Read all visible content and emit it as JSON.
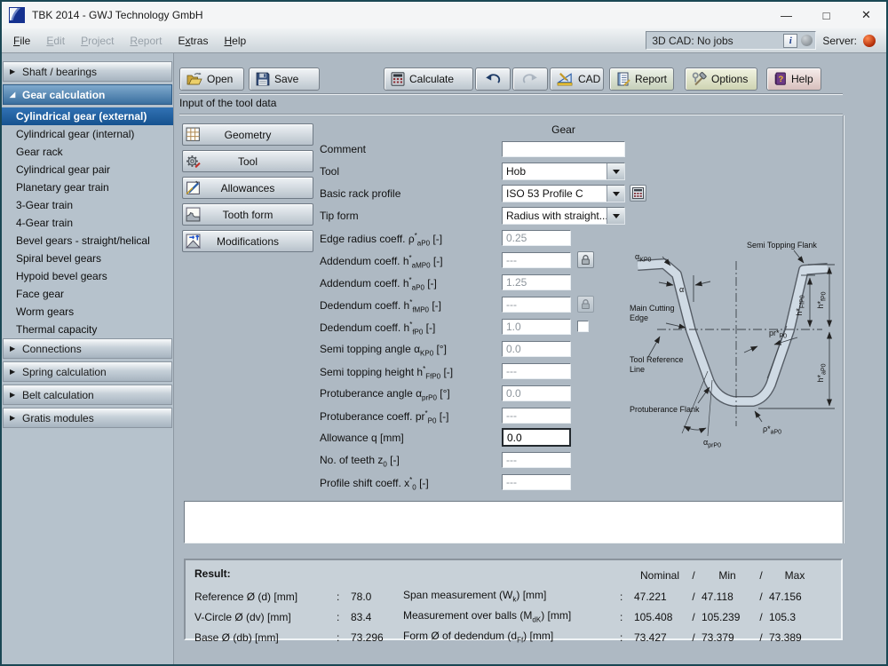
{
  "window": {
    "title": "TBK 2014 - GWJ Technology GmbH"
  },
  "titlebar": {
    "minimize": "—",
    "maximize": "□",
    "close": "✕"
  },
  "menubar": {
    "items": [
      {
        "label": "File",
        "u": 0,
        "enabled": true
      },
      {
        "label": "Edit",
        "u": 0,
        "enabled": false
      },
      {
        "label": "Project",
        "u": 0,
        "enabled": false
      },
      {
        "label": "Report",
        "u": 0,
        "enabled": false
      },
      {
        "label": "Extras",
        "u": 1,
        "enabled": true
      },
      {
        "label": "Help",
        "u": 0,
        "enabled": true
      }
    ],
    "cad_status": "3D CAD: No jobs",
    "info_button": "i",
    "server_label": "Server:"
  },
  "sidebar": {
    "groups": [
      {
        "label": "Shaft / bearings",
        "expanded": false
      },
      {
        "label": "Gear calculation",
        "expanded": true,
        "selected": "Cylindrical gear (external)",
        "items": [
          "Cylindrical gear (external)",
          "Cylindrical gear (internal)",
          "Gear rack",
          "Cylindrical gear pair",
          "Planetary gear train",
          "3-Gear train",
          "4-Gear train",
          "Bevel gears - straight/helical",
          "Spiral bevel gears",
          "Hypoid bevel gears",
          "Face gear",
          "Worm gears",
          "Thermal capacity"
        ]
      },
      {
        "label": "Connections",
        "expanded": false
      },
      {
        "label": "Spring calculation",
        "expanded": false
      },
      {
        "label": "Belt calculation",
        "expanded": false
      },
      {
        "label": "Gratis modules",
        "expanded": false
      }
    ]
  },
  "toolbar": {
    "open": "Open",
    "save": "Save",
    "calculate": "Calculate",
    "cad": "CAD",
    "report": "Report",
    "options": "Options",
    "help": "Help"
  },
  "section_title": "Input of the tool data",
  "buttons": {
    "geometry": "Geometry",
    "tool": "Tool",
    "allowances": "Allowances",
    "tooth_form": "Tooth form",
    "modifications": "Modifications"
  },
  "form": {
    "column_header": "Gear",
    "rows": [
      {
        "id": "comment",
        "label": [
          [
            "t",
            "Comment"
          ]
        ],
        "type": "text",
        "value": "",
        "state": "enabled",
        "wide": true
      },
      {
        "id": "tool",
        "label": [
          [
            "t",
            "Tool"
          ]
        ],
        "type": "select",
        "value": "Hob"
      },
      {
        "id": "basic-rack-profile",
        "label": [
          [
            "t",
            "Basic rack profile"
          ]
        ],
        "type": "select",
        "value": "ISO 53 Profile C",
        "extra": "calc"
      },
      {
        "id": "tip-form",
        "label": [
          [
            "t",
            "Tip form"
          ]
        ],
        "type": "select",
        "value": "Radius with straight..."
      },
      {
        "id": "edge-radius-coeff",
        "label": [
          [
            "t",
            "Edge radius coeff. ρ"
          ],
          [
            "sup",
            "*"
          ],
          [
            "sub",
            "aP0"
          ],
          [
            "t",
            " [-]"
          ]
        ],
        "type": "text",
        "value": "0.25",
        "state": "disabled"
      },
      {
        "id": "addendum-coeff-amp0",
        "label": [
          [
            "t",
            "Addendum coeff. h"
          ],
          [
            "sup",
            "*"
          ],
          [
            "sub",
            "aMP0"
          ],
          [
            "t",
            " [-]"
          ]
        ],
        "type": "text",
        "value": "---",
        "state": "disabled",
        "extra": "lock"
      },
      {
        "id": "addendum-coeff-ap0",
        "label": [
          [
            "t",
            "Addendum coeff. h"
          ],
          [
            "sup",
            "*"
          ],
          [
            "sub",
            "aP0"
          ],
          [
            "t",
            " [-]"
          ]
        ],
        "type": "text",
        "value": "1.25",
        "state": "disabled"
      },
      {
        "id": "dedendum-coeff-fmp0",
        "label": [
          [
            "t",
            "Dedendum coeff. h"
          ],
          [
            "sup",
            "*"
          ],
          [
            "sub",
            "fMP0"
          ],
          [
            "t",
            " [-]"
          ]
        ],
        "type": "text",
        "value": "---",
        "state": "disabled",
        "extra": "lock-disabled"
      },
      {
        "id": "dedendum-coeff-fp0",
        "label": [
          [
            "t",
            "Dedendum coeff. h"
          ],
          [
            "sup",
            "*"
          ],
          [
            "sub",
            "fP0"
          ],
          [
            "t",
            " [-]"
          ]
        ],
        "type": "text",
        "value": "1.0",
        "state": "disabled",
        "extra": "checkbox"
      },
      {
        "id": "semi-topping-angle",
        "label": [
          [
            "t",
            "Semi topping angle α"
          ],
          [
            "sub",
            "KP0"
          ],
          [
            "t",
            " [°]"
          ]
        ],
        "type": "text",
        "value": "0.0",
        "state": "disabled"
      },
      {
        "id": "semi-topping-height",
        "label": [
          [
            "t",
            "Semi topping height h"
          ],
          [
            "sup",
            "*"
          ],
          [
            "sub",
            "FfP0"
          ],
          [
            "t",
            " [-]"
          ]
        ],
        "type": "text",
        "value": "---",
        "state": "disabled"
      },
      {
        "id": "protuberance-angle",
        "label": [
          [
            "t",
            "Protuberance angle α"
          ],
          [
            "sub",
            "prP0"
          ],
          [
            "t",
            " [°]"
          ]
        ],
        "type": "text",
        "value": "0.0",
        "state": "disabled"
      },
      {
        "id": "protuberance-coeff",
        "label": [
          [
            "t",
            "Protuberance coeff. pr"
          ],
          [
            "sup",
            "*"
          ],
          [
            "sub",
            "P0"
          ],
          [
            "t",
            " [-]"
          ]
        ],
        "type": "text",
        "value": "---",
        "state": "disabled"
      },
      {
        "id": "allowance-q",
        "label": [
          [
            "t",
            "Allowance q [mm]"
          ]
        ],
        "type": "text",
        "value": "0.0",
        "state": "active"
      },
      {
        "id": "no-of-teeth",
        "label": [
          [
            "t",
            "No. of teeth z"
          ],
          [
            "sub",
            "0"
          ],
          [
            "t",
            " [-]"
          ]
        ],
        "type": "text",
        "value": "---",
        "state": "disabled"
      },
      {
        "id": "profile-shift-coeff",
        "label": [
          [
            "t",
            "Profile shift coeff. x"
          ],
          [
            "sup",
            "*"
          ],
          [
            "sub",
            "0"
          ],
          [
            "t",
            " [-]"
          ]
        ],
        "type": "text",
        "value": "---",
        "state": "disabled"
      }
    ]
  },
  "diagram": {
    "labels": {
      "alpha_kp0": [
        [
          "t",
          "α"
        ],
        [
          "sub",
          "KP0"
        ]
      ],
      "semi_topping_flank": [
        [
          "t",
          "Semi Topping Flank"
        ]
      ],
      "alpha": [
        [
          "t",
          "α"
        ]
      ],
      "main_cutting_edge_1": [
        [
          "t",
          "Main Cutting"
        ]
      ],
      "main_cutting_edge_2": [
        [
          "t",
          "Edge"
        ]
      ],
      "tool_reference_line_1": [
        [
          "t",
          "Tool Reference"
        ]
      ],
      "tool_reference_line_2": [
        [
          "t",
          "Line"
        ]
      ],
      "protuberance_flank": [
        [
          "t",
          "Protuberance Flank"
        ]
      ],
      "alpha_prp0": [
        [
          "t",
          "α"
        ],
        [
          "sub",
          "prP0"
        ]
      ],
      "rho_ap0": [
        [
          "t",
          "ρ*"
        ],
        [
          "sub",
          "aP0"
        ]
      ],
      "pr_p0": [
        [
          "t",
          "pr*"
        ],
        [
          "sub",
          "P0"
        ]
      ],
      "h_ffp0": [
        [
          "t",
          "h*"
        ],
        [
          "sub",
          "FfP0"
        ]
      ],
      "h_fp0": [
        [
          "t",
          "h*"
        ],
        [
          "sub",
          "fP0"
        ]
      ],
      "h_ap0": [
        [
          "t",
          "h*"
        ],
        [
          "sub",
          "aP0"
        ]
      ]
    }
  },
  "message_area": {
    "value": ""
  },
  "result": {
    "title": "Result:",
    "headers": {
      "nominal": "Nominal",
      "min": "Min",
      "max": "Max",
      "sep": "/"
    },
    "left": [
      {
        "label": [
          [
            "t",
            "Reference Ø (d) [mm]"
          ]
        ],
        "colon": ":",
        "value": "78.0"
      },
      {
        "label": [
          [
            "t",
            "V-Circle Ø (dv) [mm]"
          ]
        ],
        "colon": ":",
        "value": "83.4"
      },
      {
        "label": [
          [
            "t",
            "Base Ø (db) [mm]"
          ]
        ],
        "colon": ":",
        "value": "73.296"
      }
    ],
    "right": [
      {
        "label": [
          [
            "t",
            "Span measurement (W"
          ],
          [
            "sub",
            "k"
          ],
          [
            "t",
            ") [mm]"
          ]
        ],
        "colon": ":",
        "nominal": "47.221",
        "min": "47.118",
        "max": "47.156"
      },
      {
        "label": [
          [
            "t",
            "Measurement over balls (M"
          ],
          [
            "sub",
            "dK"
          ],
          [
            "t",
            ") [mm]"
          ]
        ],
        "colon": ":",
        "nominal": "105.408",
        "min": "105.239",
        "max": "105.3"
      },
      {
        "label": [
          [
            "t",
            "Form Ø of dedendum (d"
          ],
          [
            "sub",
            "Ff"
          ],
          [
            "t",
            ") [mm]"
          ]
        ],
        "colon": ":",
        "nominal": "73.427",
        "min": "73.379",
        "max": "73.389"
      }
    ]
  },
  "colors": {
    "window_border": "#1a4754",
    "content_background": "#aeb9c3",
    "logo_blue": "#15318f",
    "group_header_blue": "#4f7fae",
    "selected_item_blue": "#1c589a",
    "server_led_red": "#c23b10",
    "diagram_band_fill": "#cfdae4"
  }
}
